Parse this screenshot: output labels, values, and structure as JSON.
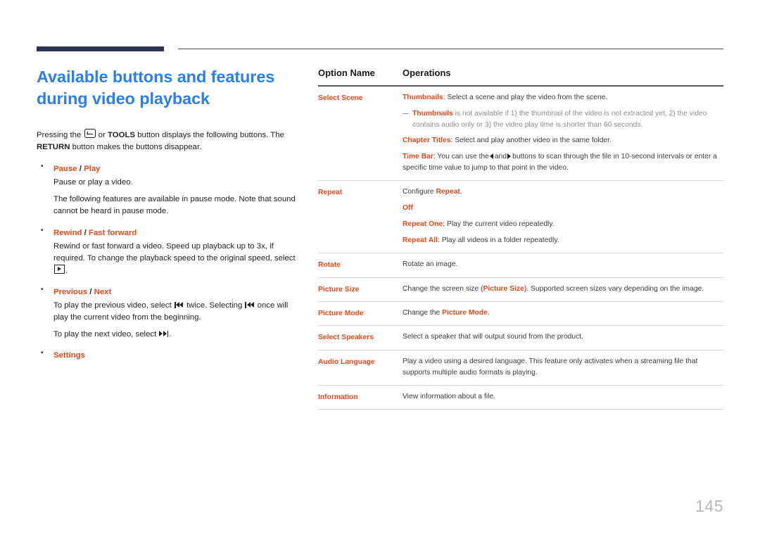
{
  "page": {
    "number": "145"
  },
  "left": {
    "title": "Available buttons and features during video playback",
    "intro_before": "Pressing the",
    "intro_mid": "or",
    "intro_tools": "TOOLS",
    "intro_after": "button displays the following buttons. The",
    "intro_return": "RETURN",
    "intro_end": "button makes the buttons disappear.",
    "bullets": [
      {
        "title_a": "Pause",
        "sep": " / ",
        "title_b": "Play",
        "paras": [
          "Pause or play a video.",
          "The following features are available in pause mode. Note that sound cannot be heard in pause mode."
        ]
      },
      {
        "title_a": "Rewind",
        "sep": " / ",
        "title_b": "Fast forward",
        "para_1a": "Rewind or fast forward a video. Speed up playback up to 3x, if required. To change the playback speed to the original speed, select",
        "para_1b": "."
      },
      {
        "title_a": "Previous",
        "sep": " / ",
        "title_b": "Next",
        "para_1a": "To play the previous video, select",
        "para_1b": "twice. Selecting",
        "para_1c": "once will play the current video from the beginning.",
        "para_2a": "To play the next video, select",
        "para_2b": "."
      },
      {
        "title_a": "Settings",
        "sep": "",
        "title_b": ""
      }
    ]
  },
  "table": {
    "headers": {
      "option": "Option Name",
      "operations": "Operations"
    },
    "rows": [
      {
        "name": "Select Scene",
        "lines": [
          {
            "kind": "kw",
            "kw": "Thumbnails",
            "text": ": Select a scene and play the video from the scene."
          },
          {
            "kind": "note",
            "kw": "Thumbnails",
            "text": " is not available if 1) the thumbnail of the video is not extracted yet, 2) the video contains audio only or 3) the video play time is shorter than 60 seconds."
          },
          {
            "kind": "kw",
            "kw": "Chapter Titles",
            "text": ": Select and play another video in the same folder."
          },
          {
            "kind": "timebar",
            "kw": "Time Bar",
            "text_a": ": You can use the",
            "text_b": "and",
            "text_c": "buttons to scan through the file in 10-second intervals or enter a specific time value to jump to that point in the video."
          }
        ]
      },
      {
        "name": "Repeat",
        "lines": [
          {
            "kind": "lead",
            "pre": "Configure ",
            "kw": "Repeat",
            "text": "."
          },
          {
            "kind": "kwonly",
            "kw": "Off",
            "text": ""
          },
          {
            "kind": "kw",
            "kw": "Repeat One",
            "text": ": Play the current video repeatedly."
          },
          {
            "kind": "kw",
            "kw": "Repeat All",
            "text": ": Play all videos in a folder repeatedly."
          }
        ]
      },
      {
        "name": "Rotate",
        "lines": [
          {
            "kind": "plain",
            "text": "Rotate an image."
          }
        ]
      },
      {
        "name": "Picture Size",
        "lines": [
          {
            "kind": "lead",
            "pre": "Change the screen size (",
            "kw": "Picture Size",
            "text": "). Supported screen sizes vary depending on the image."
          }
        ]
      },
      {
        "name": "Picture Mode",
        "lines": [
          {
            "kind": "lead",
            "pre": "Change the ",
            "kw": "Picture Mode",
            "text": "."
          }
        ]
      },
      {
        "name": "Select Speakers",
        "lines": [
          {
            "kind": "plain",
            "text": "Select a speaker that will output sound from the product."
          }
        ]
      },
      {
        "name": "Audio Language",
        "lines": [
          {
            "kind": "plain",
            "text": "Play a video using a desired language. This feature only activates when a streaming file that supports multiple audio formats is playing."
          }
        ]
      },
      {
        "name": "Information",
        "lines": [
          {
            "kind": "plain",
            "text": "View information about a file."
          }
        ]
      }
    ]
  },
  "colors": {
    "heading_blue": "#2d7fe8",
    "accent_orange": "#e8481c",
    "rule_navy": "#2e3352",
    "body_text": "#231f20",
    "note_gray": "#8e8e8e",
    "page_number_gray": "#b8b8b8"
  }
}
